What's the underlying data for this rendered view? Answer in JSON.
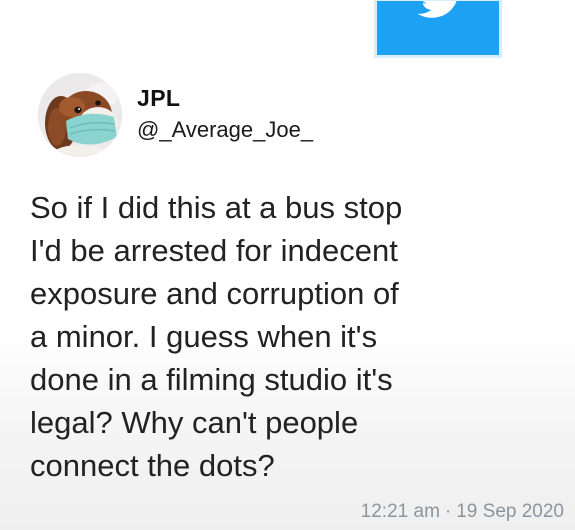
{
  "tweet": {
    "display_name": "JPL",
    "handle": "@_Average_Joe_",
    "text_lines": [
      "So if I did this at a bus stop",
      "I'd be arrested for indecent",
      "exposure and corruption of",
      "a minor. I guess when it's",
      "done in a filming studio it's",
      "legal? Why can't people",
      "connect the dots?"
    ],
    "time": "12:21 am",
    "separator": "·",
    "date": "19 Sep 2020"
  },
  "icons": {
    "logo": "twitter-bird-icon",
    "avatar": "dog-with-face-mask"
  },
  "colors": {
    "twitter_blue": "#1da1f2",
    "text": "#222222",
    "meta_text": "#8b959e",
    "mask": "#8ad3cf"
  }
}
